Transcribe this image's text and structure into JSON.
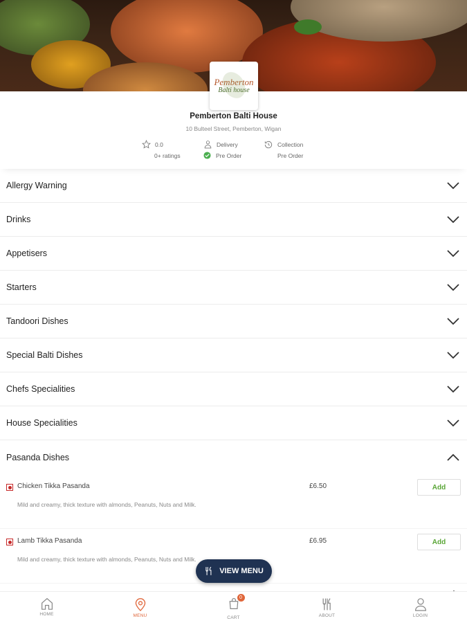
{
  "restaurant": {
    "logo_line1": "Pemberton",
    "logo_line2": "Balti house",
    "name": "Pemberton Balti House",
    "address": "10 Bulteel Street, Pemberton, Wigan",
    "rating": "0.0",
    "ratings_count": "0+ ratings",
    "delivery_label": "Delivery",
    "delivery_status": "Pre Order",
    "collection_label": "Collection",
    "collection_status": "Pre Order"
  },
  "categories": [
    {
      "label": "Allergy Warning",
      "expanded": false
    },
    {
      "label": "Drinks",
      "expanded": false
    },
    {
      "label": "Appetisers",
      "expanded": false
    },
    {
      "label": "Starters",
      "expanded": false
    },
    {
      "label": "Tandoori Dishes",
      "expanded": false
    },
    {
      "label": "Special Balti Dishes",
      "expanded": false
    },
    {
      "label": "Chefs Specialities",
      "expanded": false
    },
    {
      "label": "House Specialities",
      "expanded": false
    },
    {
      "label": "Pasanda Dishes",
      "expanded": true
    }
  ],
  "items": [
    {
      "name": "Chicken Tikka Pasanda",
      "price": "£6.50",
      "description": "Mild and creamy, thick texture with almonds, Peanuts, Nuts and Milk.",
      "add_label": "Add"
    },
    {
      "name": "Lamb Tikka Pasanda",
      "price": "£6.95",
      "description": "Mild and creamy, thick texture with almonds, Peanuts, Nuts and Milk.",
      "add_label": "Add"
    }
  ],
  "view_menu_label": "VIEW MENU",
  "nav": {
    "home": "HOME",
    "menu": "MENU",
    "cart": "CART",
    "cart_count": "0",
    "about": "ABOUT",
    "login": "LOGIN"
  },
  "colors": {
    "accent": "#e0663a",
    "add_green": "#5aa637",
    "view_menu_bg": "#1f3252",
    "veg_marker": "#c62828"
  }
}
